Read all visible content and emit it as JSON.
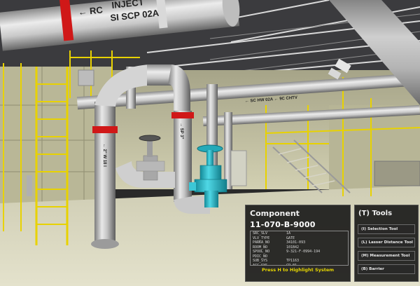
{
  "scene": {
    "pipe_labels": {
      "top_pipe_rc": "← RC",
      "top_pipe_line1": "INJECT",
      "top_pipe_line2": "SI SCP 02A",
      "vertical_pipe_left": "← 2\" W 18 I",
      "vertical_pipe_right": "→ SP 3\"",
      "mid_pipe": "← SC HW 02A   ← 9C CHTV"
    },
    "colors": {
      "highlight_valve": "#2ab8c8",
      "pipe_band": "#d01818",
      "railing": "#e8d200",
      "ceiling": "#3a3a3c",
      "walls": "#c8c6a4",
      "floor": "#d9d8c0"
    }
  },
  "component_panel": {
    "header": "Component",
    "id": "11-070-B-9000",
    "properties": [
      {
        "key": "SRC_SLV",
        "value": "1A"
      },
      {
        "key": "VLV_TYPE",
        "value": "GATE"
      },
      {
        "key": "PARKA_NO",
        "value": "34101-093"
      },
      {
        "key": "ROOM_NO",
        "value": "101B42"
      },
      {
        "key": "SPOOL_NO",
        "value": "9-321-F-0994-194"
      },
      {
        "key": "PDIC_NO",
        "value": ""
      },
      {
        "key": "SUB_SYS",
        "value": "TP1163"
      },
      {
        "key": "ACC_SYS",
        "value": "CP-01"
      },
      {
        "key": "ISO_DWG",
        "value": "9-313-F374-H8634"
      },
      {
        "key": "AISOM.T",
        "value": ""
      }
    ],
    "hint": "Press H to Highlight System"
  },
  "tools_panel": {
    "header": "(T) Tools",
    "items": [
      {
        "label": "(I) Selection Tool"
      },
      {
        "label": "(L) Lasser Distance Tool"
      },
      {
        "label": "(M) Measurement Tool"
      },
      {
        "label": "(B) Barrier"
      }
    ]
  }
}
